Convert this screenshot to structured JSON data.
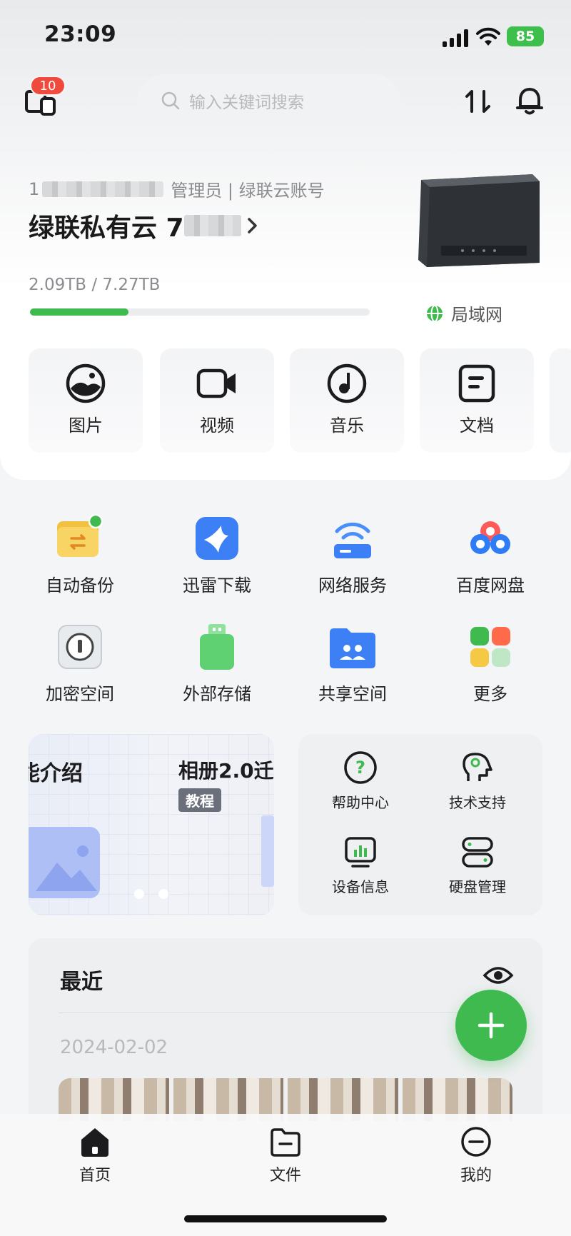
{
  "status": {
    "time": "23:09",
    "battery": "85"
  },
  "header": {
    "badge_count": "10",
    "search_placeholder": "输入关键词搜索"
  },
  "account": {
    "id_prefix": "1",
    "roles": "管理员 | 绿联云账号",
    "name_prefix": "绿联私有云 7",
    "storage": "2.09TB / 7.27TB",
    "storage_used_fraction": 0.29,
    "network": "局域网"
  },
  "categories": [
    {
      "label": "图片",
      "icon": "photo-icon"
    },
    {
      "label": "视频",
      "icon": "video-icon"
    },
    {
      "label": "音乐",
      "icon": "music-icon"
    },
    {
      "label": "文档",
      "icon": "document-icon"
    }
  ],
  "apps": [
    {
      "label": "自动备份",
      "icon": "auto-backup-icon"
    },
    {
      "label": "迅雷下载",
      "icon": "thunder-download-icon"
    },
    {
      "label": "网络服务",
      "icon": "network-service-icon"
    },
    {
      "label": "百度网盘",
      "icon": "baidu-netdisk-icon"
    },
    {
      "label": "加密空间",
      "icon": "encrypted-space-icon"
    },
    {
      "label": "外部存储",
      "icon": "external-storage-icon"
    },
    {
      "label": "共享空间",
      "icon": "shared-space-icon"
    },
    {
      "label": "更多",
      "icon": "more-apps-icon"
    }
  ],
  "banner": {
    "title1": "能介绍",
    "title2": "相册2.0迁",
    "tag": "教程"
  },
  "tools": [
    {
      "label": "帮助中心",
      "icon": "help-center-icon"
    },
    {
      "label": "技术支持",
      "icon": "tech-support-icon"
    },
    {
      "label": "设备信息",
      "icon": "device-info-icon"
    },
    {
      "label": "硬盘管理",
      "icon": "disk-management-icon"
    }
  ],
  "recent": {
    "title": "最近",
    "date": "2024-02-02"
  },
  "nav": [
    {
      "label": "首页",
      "icon": "home-icon"
    },
    {
      "label": "文件",
      "icon": "files-icon"
    },
    {
      "label": "我的",
      "icon": "profile-icon"
    }
  ],
  "colors": {
    "accent": "#3fba4f",
    "badge": "#f04a3d"
  }
}
